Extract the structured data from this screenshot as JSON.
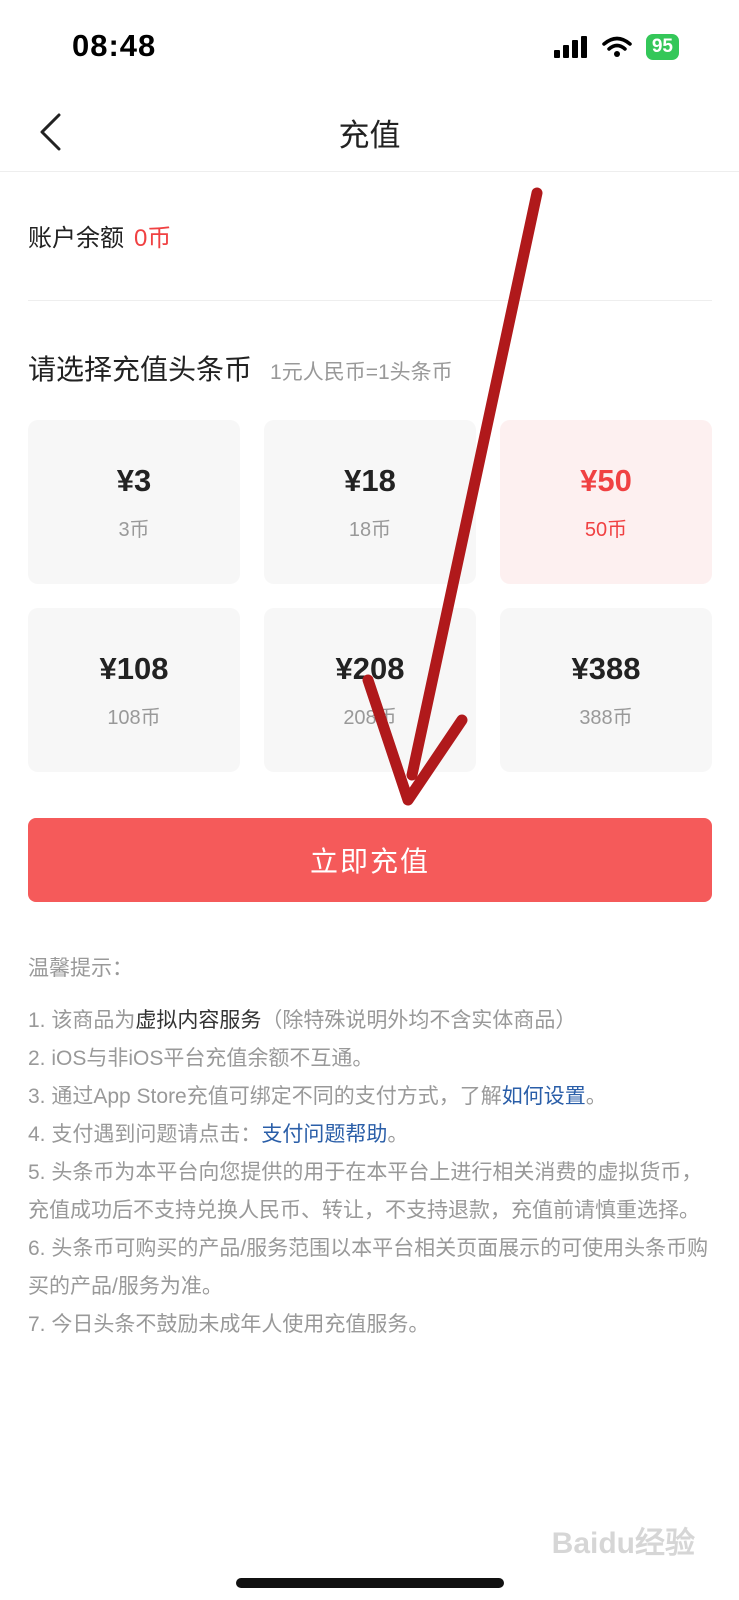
{
  "status": {
    "time": "08:48",
    "battery": "95"
  },
  "nav": {
    "title": "充值"
  },
  "balance": {
    "label": "账户余额",
    "value": "0币"
  },
  "section": {
    "title": "请选择充值头条币",
    "note": "1元人民币=1头条币"
  },
  "options": [
    {
      "price": "¥3",
      "coins": "3币",
      "selected": false
    },
    {
      "price": "¥18",
      "coins": "18币",
      "selected": false
    },
    {
      "price": "¥50",
      "coins": "50币",
      "selected": true
    },
    {
      "price": "¥108",
      "coins": "108币",
      "selected": false
    },
    {
      "price": "¥208",
      "coins": "208币",
      "selected": false
    },
    {
      "price": "¥388",
      "coins": "388币",
      "selected": false
    }
  ],
  "cta": {
    "label": "立即充值"
  },
  "tips": {
    "title": "温馨提示：",
    "t1a": "1. 该商品为",
    "t1b": "虚拟内容服务",
    "t1c": "（除特殊说明外均不含实体商品）",
    "t2": "2. iOS与非iOS平台充值余额不互通。",
    "t3a": "3. 通过App Store充值可绑定不同的支付方式，了解",
    "t3link": "如何设置",
    "t3b": "。",
    "t4a": "4. 支付遇到问题请点击：",
    "t4link": "支付问题帮助",
    "t4b": "。",
    "t5": "5. 头条币为本平台向您提供的用于在本平台上进行相关消费的虚拟货币，充值成功后不支持兑换人民币、转让，不支持退款，充值前请慎重选择。",
    "t6": "6. 头条币可购买的产品/服务范围以本平台相关页面展示的可使用头条币购买的产品/服务为准。",
    "t7": "7. 今日头条不鼓励未成年人使用充值服务。"
  },
  "watermark": "Baidu经验",
  "colors": {
    "accent": "#f55a5a",
    "selected_bg": "#fdf0f0",
    "link": "#2a5ea8",
    "arrow": "#b0191b"
  }
}
